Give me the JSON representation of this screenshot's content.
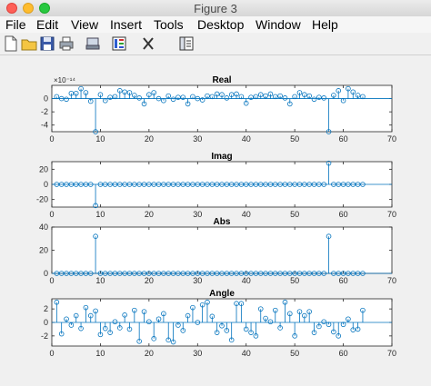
{
  "window": {
    "title": "Figure 3"
  },
  "menu": [
    "File",
    "Edit",
    "View",
    "Insert",
    "Tools",
    "Desktop",
    "Window",
    "Help"
  ],
  "toolbar": [
    "new-figure-icon",
    "open-file-icon",
    "save-icon",
    "print-icon",
    "print-preview-icon",
    "insert-colorbar-icon",
    "insert-legend-icon",
    "dock-icon"
  ],
  "colors": {
    "stem": "#0072bd",
    "axes": "#262626",
    "background": "#f0f0f0",
    "panel": "#ffffff"
  },
  "chart_data": [
    {
      "type": "stem",
      "title": "Real",
      "exponent_label": "×10⁻¹⁴",
      "xlim": [
        0,
        70
      ],
      "ylim": [
        -5,
        2
      ],
      "xticks": [
        0,
        10,
        20,
        30,
        40,
        50,
        60,
        70
      ],
      "yticks": [
        -4,
        -2,
        0
      ],
      "grid": false,
      "x": [
        1,
        2,
        3,
        4,
        5,
        6,
        7,
        8,
        9,
        10,
        11,
        12,
        13,
        14,
        15,
        16,
        17,
        18,
        19,
        20,
        21,
        22,
        23,
        24,
        25,
        26,
        27,
        28,
        29,
        30,
        31,
        32,
        33,
        34,
        35,
        36,
        37,
        38,
        39,
        40,
        41,
        42,
        43,
        44,
        45,
        46,
        47,
        48,
        49,
        50,
        51,
        52,
        53,
        54,
        55,
        56,
        57,
        58,
        59,
        60,
        61,
        62,
        63,
        64
      ],
      "y": [
        0.3,
        0.0,
        -0.1,
        0.8,
        0.8,
        1.5,
        0.9,
        -0.4,
        -5.0,
        0.6,
        -0.3,
        0.2,
        0.3,
        1.2,
        1.0,
        0.9,
        0.5,
        0.1,
        -0.8,
        0.6,
        0.9,
        0.0,
        -0.3,
        0.4,
        -0.1,
        0.2,
        0.2,
        -0.8,
        0.3,
        0.0,
        -0.2,
        0.4,
        0.3,
        0.7,
        0.6,
        0.1,
        0.6,
        0.7,
        0.3,
        -0.7,
        0.2,
        0.3,
        0.6,
        0.4,
        0.7,
        0.3,
        0.4,
        0.1,
        -0.8,
        0.3,
        0.9,
        0.6,
        0.4,
        -0.1,
        0.2,
        0.1,
        -5.0,
        0.5,
        1.2,
        -0.3,
        1.5,
        1.0,
        0.5,
        0.3
      ]
    },
    {
      "type": "stem",
      "title": "Imag",
      "xlim": [
        0,
        70
      ],
      "ylim": [
        -30,
        30
      ],
      "xticks": [
        0,
        10,
        20,
        30,
        40,
        50,
        60,
        70
      ],
      "yticks": [
        -20,
        0,
        20
      ],
      "grid": false,
      "x": [
        1,
        2,
        3,
        4,
        5,
        6,
        7,
        8,
        9,
        10,
        11,
        12,
        13,
        14,
        15,
        16,
        17,
        18,
        19,
        20,
        21,
        22,
        23,
        24,
        25,
        26,
        27,
        28,
        29,
        30,
        31,
        32,
        33,
        34,
        35,
        36,
        37,
        38,
        39,
        40,
        41,
        42,
        43,
        44,
        45,
        46,
        47,
        48,
        49,
        50,
        51,
        52,
        53,
        54,
        55,
        56,
        57,
        58,
        59,
        60,
        61,
        62,
        63,
        64
      ],
      "y": [
        0,
        0,
        0,
        0,
        0,
        0,
        0,
        0,
        -28,
        0,
        0,
        0,
        0,
        0,
        0,
        0,
        0,
        0,
        0,
        0,
        0,
        0,
        0,
        0,
        0,
        0,
        0,
        0,
        0,
        0,
        0,
        0,
        0,
        0,
        0,
        0,
        0,
        0,
        0,
        0,
        0,
        0,
        0,
        0,
        0,
        0,
        0,
        0,
        0,
        0,
        0,
        0,
        0,
        0,
        0,
        0,
        28,
        0,
        0,
        0,
        0,
        0,
        0,
        0
      ]
    },
    {
      "type": "stem",
      "title": "Abs",
      "xlim": [
        0,
        70
      ],
      "ylim": [
        0,
        40
      ],
      "xticks": [
        0,
        10,
        20,
        30,
        40,
        50,
        60,
        70
      ],
      "yticks": [
        0,
        20,
        40
      ],
      "grid": false,
      "x": [
        1,
        2,
        3,
        4,
        5,
        6,
        7,
        8,
        9,
        10,
        11,
        12,
        13,
        14,
        15,
        16,
        17,
        18,
        19,
        20,
        21,
        22,
        23,
        24,
        25,
        26,
        27,
        28,
        29,
        30,
        31,
        32,
        33,
        34,
        35,
        36,
        37,
        38,
        39,
        40,
        41,
        42,
        43,
        44,
        45,
        46,
        47,
        48,
        49,
        50,
        51,
        52,
        53,
        54,
        55,
        56,
        57,
        58,
        59,
        60,
        61,
        62,
        63,
        64
      ],
      "y": [
        0,
        0,
        0,
        0,
        0,
        0,
        0,
        0,
        32,
        0,
        0,
        0,
        0,
        0,
        0,
        0,
        0,
        0,
        0,
        0,
        0,
        0,
        0,
        0,
        0,
        0,
        0,
        0,
        0,
        0,
        0,
        0,
        0,
        0,
        0,
        0,
        0,
        0,
        0,
        0,
        0,
        0,
        0,
        0,
        0,
        0,
        0,
        0,
        0,
        0,
        0,
        0,
        0,
        0,
        0,
        0,
        32,
        0,
        0,
        0,
        0,
        0,
        0,
        0
      ]
    },
    {
      "type": "stem",
      "title": "Angle",
      "xlim": [
        0,
        70
      ],
      "ylim": [
        -3.5,
        3.5
      ],
      "xticks": [
        0,
        10,
        20,
        30,
        40,
        50,
        60,
        70
      ],
      "yticks": [
        -2,
        0,
        2
      ],
      "grid": false,
      "x": [
        1,
        2,
        3,
        4,
        5,
        6,
        7,
        8,
        9,
        10,
        11,
        12,
        13,
        14,
        15,
        16,
        17,
        18,
        19,
        20,
        21,
        22,
        23,
        24,
        25,
        26,
        27,
        28,
        29,
        30,
        31,
        32,
        33,
        34,
        35,
        36,
        37,
        38,
        39,
        40,
        41,
        42,
        43,
        44,
        45,
        46,
        47,
        48,
        49,
        50,
        51,
        52,
        53,
        54,
        55,
        56,
        57,
        58,
        59,
        60,
        61,
        62,
        63,
        64
      ],
      "y": [
        3.0,
        -1.7,
        0.5,
        -0.4,
        1.0,
        -0.9,
        2.2,
        1.0,
        1.7,
        -1.8,
        -0.9,
        -1.5,
        0.1,
        -0.8,
        1.1,
        -1.0,
        1.8,
        -2.8,
        1.6,
        0.1,
        -2.4,
        0.5,
        1.3,
        -2.6,
        -2.9,
        -0.4,
        -1.2,
        1.0,
        2.2,
        0.0,
        2.6,
        3.0,
        0.9,
        -1.5,
        -0.5,
        -1.2,
        -2.6,
        2.8,
        2.8,
        -1.0,
        -1.5,
        -2.0,
        2.0,
        0.6,
        0.1,
        1.8,
        -0.8,
        3.0,
        1.3,
        -2.0,
        1.6,
        1.0,
        1.6,
        -1.5,
        -0.6,
        0.1,
        -0.3,
        -1.4,
        -2.0,
        -0.3,
        0.5,
        -1.1,
        -1.0,
        1.8
      ]
    }
  ]
}
